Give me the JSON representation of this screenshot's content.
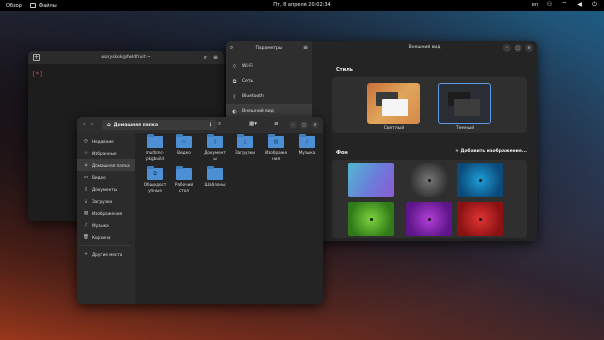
{
  "topbar": {
    "overview": "Обзор",
    "app_name": "Файлы",
    "datetime": "Пт, 8 апреля 20:02:34",
    "lang": "en"
  },
  "terminal": {
    "title": "waryskok@fwldfruit:~",
    "prompt": "[*]"
  },
  "settings": {
    "sidebar_title": "Параметры",
    "items": [
      {
        "icon": "wifi-icon",
        "label": "Wi-Fi"
      },
      {
        "icon": "network-icon",
        "label": "Сеть"
      },
      {
        "icon": "bluetooth-icon",
        "label": "Bluetooth"
      },
      {
        "icon": "appearance-icon",
        "label": "Внешний вид"
      }
    ],
    "main_title": "Внешний вид",
    "style_label": "Стиль",
    "style_light": "Светлый",
    "style_dark": "Темный",
    "bg_label": "Фон",
    "add_image": "+  Добавить изображение..."
  },
  "files": {
    "path": "Домашняя папка",
    "sidebar": [
      {
        "icon": "clock-icon",
        "label": "Недавние"
      },
      {
        "icon": "star-icon",
        "label": "Избранные"
      },
      {
        "icon": "home-icon",
        "label": "Домашняя папка"
      },
      {
        "icon": "video-icon",
        "label": "Видео"
      },
      {
        "icon": "document-icon",
        "label": "Документы"
      },
      {
        "icon": "download-icon",
        "label": "Загрузки"
      },
      {
        "icon": "image-icon",
        "label": "Изображения"
      },
      {
        "icon": "music-icon",
        "label": "Музыка"
      },
      {
        "icon": "trash-icon",
        "label": "Корзина"
      }
    ],
    "other_places": "Другие места",
    "folders": [
      {
        "name": "multimc-pkgbuild",
        "glyph": ""
      },
      {
        "name": "Видео",
        "glyph": ""
      },
      {
        "name": "Документы",
        "glyph": ""
      },
      {
        "name": "Загрузки",
        "glyph": "⤓"
      },
      {
        "name": "Изображения",
        "glyph": ""
      },
      {
        "name": "Музыка",
        "glyph": "♪"
      },
      {
        "name": "Общедоступные",
        "glyph": "⧉"
      },
      {
        "name": "Рабочий стол",
        "glyph": ""
      },
      {
        "name": "Шаблоны",
        "glyph": ""
      }
    ],
    "folder_labels": {
      "f0": "multimc-\npkgbuild",
      "f1": "Видео",
      "f2": "Документ\nы",
      "f3": "Загрузки",
      "f4": "Изображе\nния",
      "f5": "Музыка",
      "f6": "Общедост\nупные",
      "f7": "Рабочий\nстол",
      "f8": "Шаблоны"
    }
  },
  "colors": {
    "accent": "#4c8fd4",
    "window_bg": "#242424",
    "sidebar_bg": "#2e2e2e"
  }
}
